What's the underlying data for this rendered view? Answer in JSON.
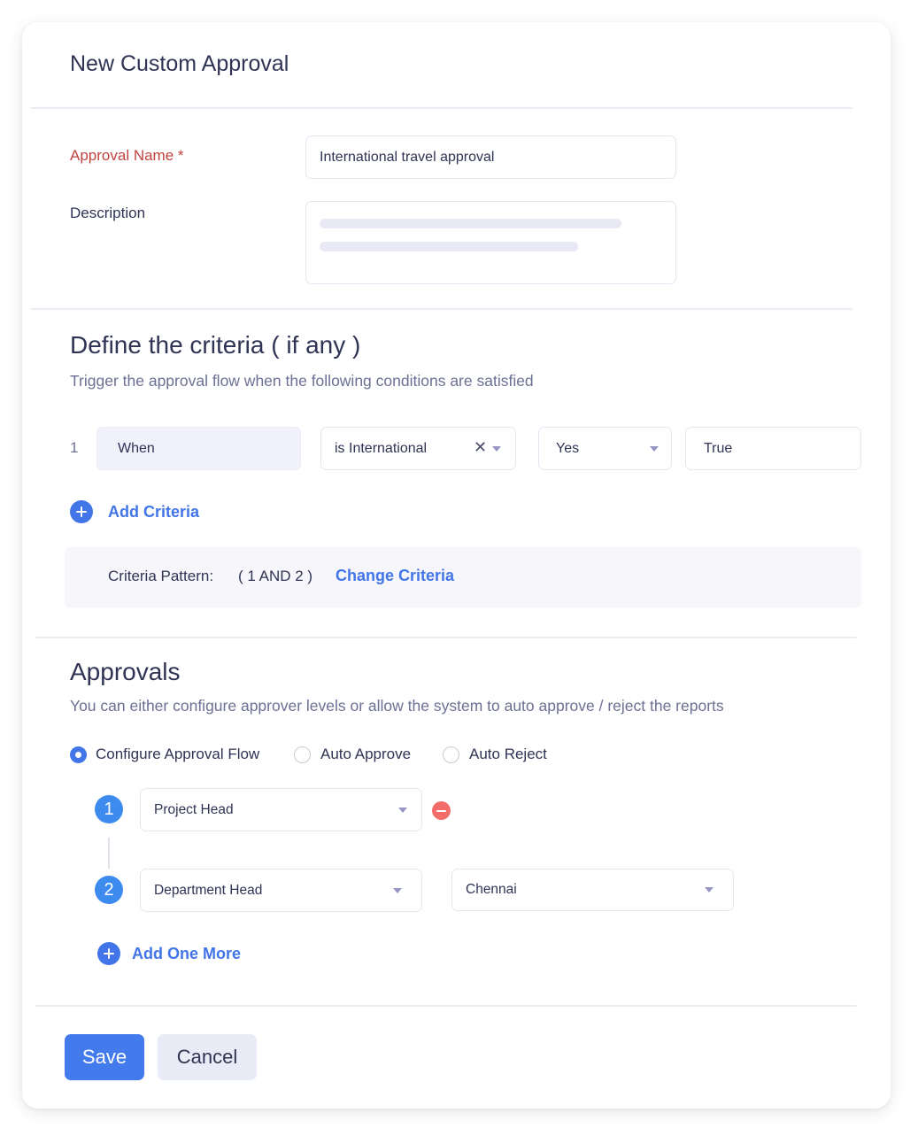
{
  "dialog": {
    "title": "New Custom Approval"
  },
  "form": {
    "approval_name_label": "Approval Name *",
    "approval_name_value": "International travel approval",
    "description_label": "Description",
    "description_value": ""
  },
  "criteria": {
    "heading": "Define the criteria ( if any )",
    "subtext": "Trigger the approval flow when the following conditions are satisfied",
    "rows": [
      {
        "index": "1",
        "field": "When",
        "condition": "is International",
        "operator": "Yes",
        "value": "True"
      }
    ],
    "add_label": "Add Criteria",
    "pattern_label": "Criteria Pattern:",
    "pattern_value": "( 1 AND 2 )",
    "change_label": "Change Criteria"
  },
  "approvals": {
    "heading": "Approvals",
    "subtext": "You can either configure approver levels  or allow the system to auto approve / reject the reports",
    "options": [
      {
        "label": "Configure Approval Flow",
        "selected": true
      },
      {
        "label": "Auto Approve",
        "selected": false
      },
      {
        "label": "Auto Reject",
        "selected": false
      }
    ],
    "levels": [
      {
        "step": "1",
        "approver": "Project Head"
      },
      {
        "step": "2",
        "approver": "Department Head",
        "location": "Chennai"
      }
    ],
    "add_label": "Add One More"
  },
  "actions": {
    "save_label": "Save",
    "cancel_label": "Cancel"
  },
  "colors": {
    "accent": "#4175e8",
    "required": "#c0433f",
    "danger": "#f26d6a",
    "step": "#3d8bef"
  }
}
